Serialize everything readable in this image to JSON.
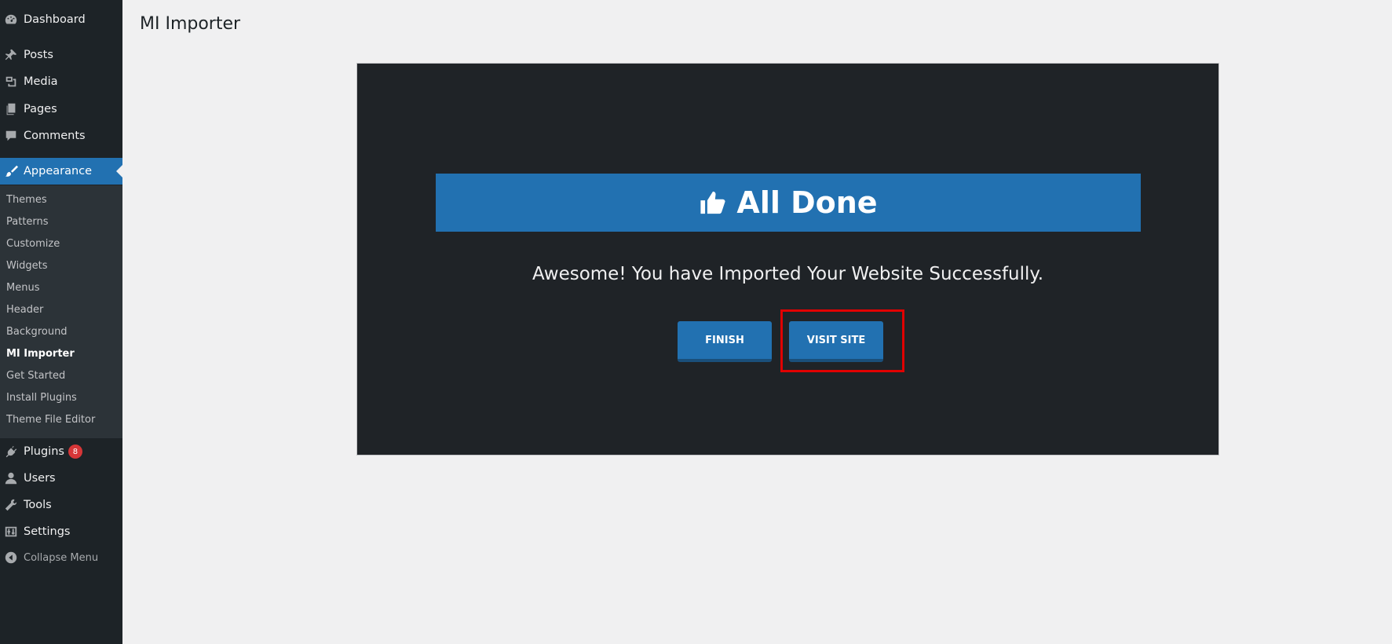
{
  "sidebar": {
    "items": [
      {
        "label": "Dashboard",
        "icon": "dashboard-icon"
      },
      {
        "label": "Posts",
        "icon": "pin-icon"
      },
      {
        "label": "Media",
        "icon": "media-icon"
      },
      {
        "label": "Pages",
        "icon": "pages-icon"
      },
      {
        "label": "Comments",
        "icon": "comment-icon"
      },
      {
        "label": "Appearance",
        "icon": "paintbrush-icon"
      },
      {
        "label": "Plugins",
        "icon": "plugin-icon",
        "badge": "8"
      },
      {
        "label": "Users",
        "icon": "user-icon"
      },
      {
        "label": "Tools",
        "icon": "wrench-icon"
      },
      {
        "label": "Settings",
        "icon": "settings-icon"
      },
      {
        "label": "Collapse Menu",
        "icon": "collapse-icon"
      }
    ],
    "submenu": [
      "Themes",
      "Patterns",
      "Customize",
      "Widgets",
      "Menus",
      "Header",
      "Background",
      "MI Importer",
      "Get Started",
      "Install Plugins",
      "Theme File Editor"
    ],
    "active_submenu": "MI Importer"
  },
  "page": {
    "title": "MI Importer"
  },
  "panel": {
    "banner_title": "All Done",
    "banner_icon": "thumbs-up-icon",
    "message": "Awesome! You have Imported Your Website Successfully.",
    "finish_label": "FINISH",
    "visit_label": "VISIT SITE"
  },
  "colors": {
    "sidebar_bg": "#1d2327",
    "accent": "#2271b1",
    "panel_bg": "#1f2327",
    "highlight": "#e00000"
  }
}
